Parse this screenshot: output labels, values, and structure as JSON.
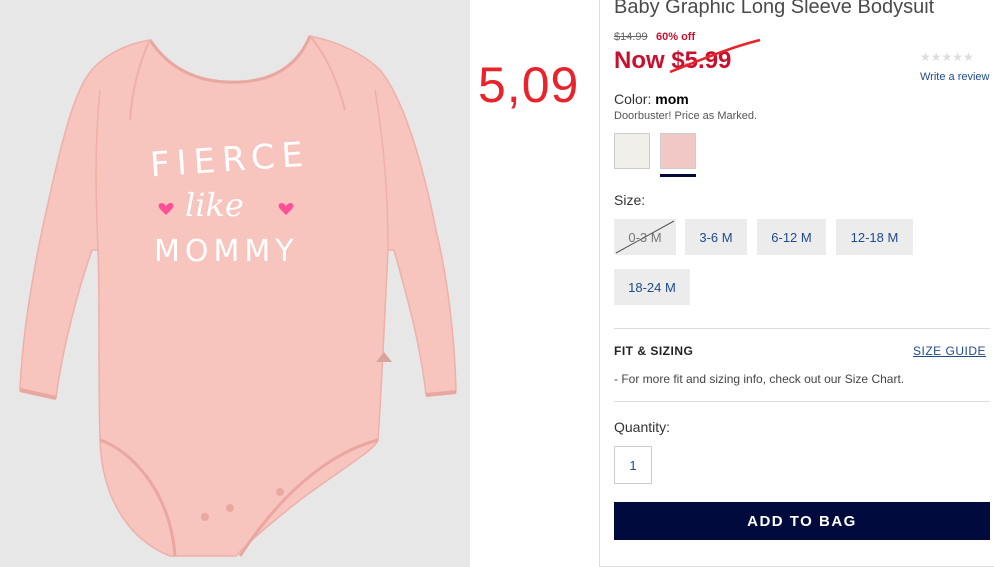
{
  "product": {
    "title": "Baby Graphic Long Sleeve Bodysuit",
    "old_price": "$14.99",
    "discount": "60% off",
    "now_price": "Now $5.99",
    "stars": "★★★★★",
    "rating_stars_filled": 0,
    "review_link": "Write a review",
    "color_label": "Color:",
    "color_value": "mom",
    "doorbuster": "Doorbuster! Price as Marked.",
    "swatches": [
      {
        "name": "cream",
        "color": "#f1efe9"
      },
      {
        "name": "pink",
        "color": "#f2c8c6",
        "selected": true
      }
    ],
    "size_label": "Size:",
    "sizes": [
      {
        "label": "0-3 M",
        "available": false
      },
      {
        "label": "3-6 M",
        "available": true
      },
      {
        "label": "6-12 M",
        "available": true
      },
      {
        "label": "12-18 M",
        "available": true
      },
      {
        "label": "18-24 M",
        "available": true
      }
    ],
    "fit_title": "FIT & SIZING",
    "size_guide": "SIZE GUIDE",
    "fit_note": "-  For more fit and sizing info, check out our Size Chart.",
    "quantity_label": "Quantity:",
    "quantity_value": "1",
    "add_button": "ADD TO BAG"
  },
  "image": {
    "print_line1": "FIERCE",
    "print_line2": "like",
    "print_line3": "MOMMY"
  },
  "annotation": {
    "handwritten_price": "5,09"
  },
  "colors": {
    "sale_red": "#c8102e",
    "navy": "#000a3c",
    "link_blue": "#1f4a8c",
    "bodysuit_pink": "#f7c2bd",
    "annotation_red": "#e8232b"
  }
}
